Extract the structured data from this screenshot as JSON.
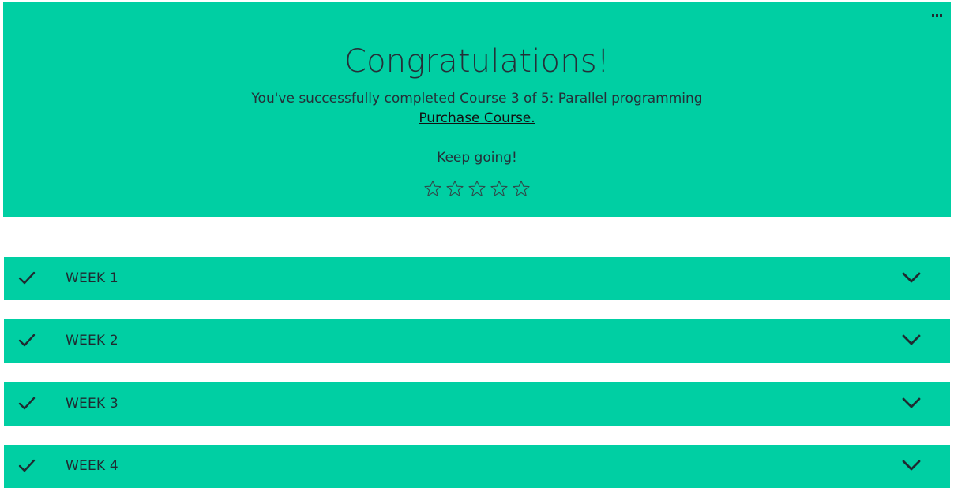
{
  "banner": {
    "title": "Congratulations!",
    "subtitle": "You've successfully completed Course 3 of 5: Parallel programming",
    "purchase_link": "Purchase Course.",
    "keep_going": "Keep going!",
    "rating": {
      "max": 5,
      "value": 0
    },
    "menu_icon": "more-dots-icon",
    "color": "#00cfa3"
  },
  "weeks": [
    {
      "label": "WEEK 1",
      "status_icon": "check-icon",
      "toggle_icon": "chevron-down-icon"
    },
    {
      "label": "WEEK 2",
      "status_icon": "check-icon",
      "toggle_icon": "chevron-down-icon"
    },
    {
      "label": "WEEK 3",
      "status_icon": "check-icon",
      "toggle_icon": "chevron-down-icon"
    },
    {
      "label": "WEEK 4",
      "status_icon": "check-icon",
      "toggle_icon": "chevron-down-icon"
    }
  ]
}
